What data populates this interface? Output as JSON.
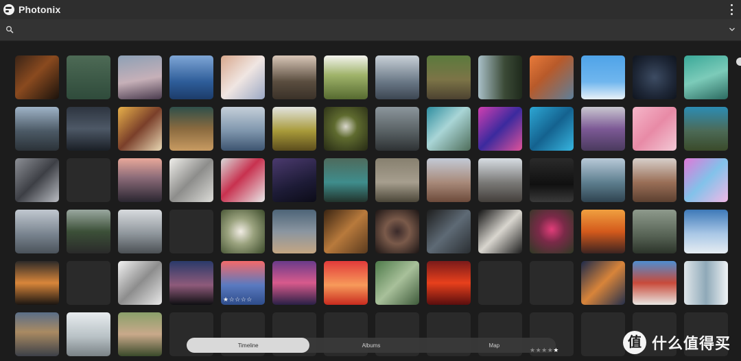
{
  "app": {
    "title": "Photonix"
  },
  "search": {
    "placeholder": ""
  },
  "icons": {
    "logo": "photonix-logo",
    "search": "search-icon",
    "menu": "more-vert-icon",
    "expand": "chevron-down-icon"
  },
  "tabs": [
    {
      "label": "Timeline",
      "active": true
    },
    {
      "label": "Albums",
      "active": false
    },
    {
      "label": "Map",
      "active": false
    }
  ],
  "watermark": {
    "text": "什么值得买"
  },
  "rows": [
    [
      {
        "bg": "linear-gradient(135deg,#3a2417 0%,#8a4a1f 45%,#1a120c 100%)"
      },
      {
        "bg": "linear-gradient(180deg,#4d6a55 0%,#2f4b3b 100%)"
      },
      {
        "bg": "linear-gradient(170deg,#8da0b5 0%,#c6b0b8 55%,#4a3b4e 100%)"
      },
      {
        "bg": "linear-gradient(180deg,#7fa6d6 0%,#2e5d99 60%,#1c3c6a 100%)"
      },
      {
        "bg": "linear-gradient(135deg,#d8a88d 0%,#f0e6e2 50%,#9aa7c4 100%)"
      },
      {
        "bg": "linear-gradient(180deg,#d9c7b8 0%,#5a4d3f 60%,#3a3128 100%)"
      },
      {
        "bg": "linear-gradient(180deg,#f4f4ef 0%,#9fb36a 45%,#566a30 100%)"
      },
      {
        "bg": "linear-gradient(180deg,#c9d1d8 0%,#6a7886 60%,#3c4652 100%)"
      },
      {
        "bg": "linear-gradient(180deg,#5b7a3d 0%,#7c7447 55%,#4c4230 100%)"
      },
      {
        "bg": "linear-gradient(90deg,#a9c0c8 0%,#3b4a36 60%,#1f2a1c 100%)"
      },
      {
        "bg": "linear-gradient(135deg,#e87a3a 0%,#b85a2a 40%,#5d7f9a 100%)"
      },
      {
        "bg": "linear-gradient(180deg,#4fa3e8 0%,#6fb6ee 60%,#e9f2f8 100%)"
      },
      {
        "bg": "radial-gradient(circle at 50% 50%,#3d4c63 0%,#1e2737 60%,#0f141d 100%)"
      },
      {
        "bg": "linear-gradient(160deg,#3aa898 0%,#7ccbb9 50%,#2b6a60 100%)"
      }
    ],
    [
      {
        "bg": "linear-gradient(180deg,#9fb3c7 0%,#4c5a66 55%,#2b3238 100%)"
      },
      {
        "bg": "linear-gradient(180deg,#2e3540 0%,#4d5866 50%,#1a1f26 100%)"
      },
      {
        "bg": "linear-gradient(135deg,#e7b04a 0%,#7a3f2a 50%,#e9d8b4 100%)"
      },
      {
        "bg": "linear-gradient(180deg,#2f4f4a 0%,#8a6a3f 50%,#c89b62 100%)"
      },
      {
        "bg": "linear-gradient(180deg,#c5cfd9 0%,#7f96ad 55%,#3d5470 100%)"
      },
      {
        "bg": "linear-gradient(180deg,#e2e4e0 0%,#a89a3a 55%,#5b4c1c 100%)"
      },
      {
        "bg": "radial-gradient(circle at 50% 45%,#d9d7cc 0%,#5f6b2f 35%,#262a14 100%)"
      },
      {
        "bg": "linear-gradient(180deg,#8c969c 0%,#555d60 60%,#2e3234 100%)"
      },
      {
        "bg": "linear-gradient(135deg,#2e8ea0 0%,#a9d5d6 45%,#4e6d5a 100%)"
      },
      {
        "bg": "linear-gradient(135deg,#d13fb0 0%,#3b2a9e 50%,#e0529a 100%)"
      },
      {
        "bg": "linear-gradient(135deg,#2da7d4 0%,#14628f 50%,#37b6e0 100%)"
      },
      {
        "bg": "linear-gradient(180deg,#c9c7d0 0%,#7d5a96 50%,#4a3a5e 100%)"
      },
      {
        "bg": "linear-gradient(135deg,#f5b6c9 0%,#e88aa6 50%,#f3cad6 100%)"
      },
      {
        "bg": "linear-gradient(180deg,#2c8cb3 0%,#4c6a56 55%,#3a4a2a 100%)"
      }
    ],
    [
      {
        "bg": "linear-gradient(135deg,#8c8f95 0%,#3d3f45 50%,#b9bcc2 100%)"
      },
      {
        "empty": true
      },
      {
        "bg": "linear-gradient(180deg,#e8a89a 0%,#8a6a78 45%,#2a2630 100%)"
      },
      {
        "bg": "linear-gradient(135deg,#efeeea 0%,#8d8d8b 50%,#dcdcd8 100%)"
      },
      {
        "bg": "linear-gradient(135deg,#d8d8d8 0%,#c8314f 45%,#e8e8e8 100%)"
      },
      {
        "bg": "linear-gradient(160deg,#4b3a6e 0%,#1d1b36 60%,#0c0c18 100%)"
      },
      {
        "bg": "linear-gradient(180deg,#4e6a5c 0%,#3f8d8c 55%,#22332c 100%)"
      },
      {
        "bg": "linear-gradient(180deg,#87806f 0%,#a69e8e 55%,#4b4638 100%)"
      },
      {
        "bg": "linear-gradient(180deg,#c3cad6 0%,#a88a7a 55%,#6d4a3a 100%)"
      },
      {
        "bg": "linear-gradient(180deg,#d7dde3 0%,#7b7a78 55%,#433f3b 100%)"
      },
      {
        "bg": "linear-gradient(180deg,#2a2a2a 0%,#101010 60%,#3a3a3a 100%)"
      },
      {
        "bg": "linear-gradient(180deg,#b8c9d8 0%,#5e7f8f 55%,#2f4350 100%)"
      },
      {
        "bg": "linear-gradient(180deg,#d7cfca 0%,#9a6f57 55%,#5c4030 100%)"
      },
      {
        "bg": "linear-gradient(135deg,#e078d8 0%,#82c2ea 50%,#f2b8e6 100%)"
      }
    ],
    [
      {
        "bg": "linear-gradient(180deg,#c1c8d0 0%,#7a8590 55%,#4a525a 100%)"
      },
      {
        "bg": "linear-gradient(180deg,#9aa8a0 0%,#3c5038 50%,#2a2a2a 100%)"
      },
      {
        "bg": "linear-gradient(180deg,#d8dbde 0%,#8f969c 55%,#4b5054 100%)"
      },
      {
        "empty": true
      },
      {
        "bg": "radial-gradient(circle at 45% 50%,#f1ece4 0%,#9aa27e 40%,#3b4a2a 100%)"
      },
      {
        "bg": "linear-gradient(180deg,#4d6478 0%,#8a95a0 50%,#c4a683 100%)"
      },
      {
        "bg": "linear-gradient(135deg,#3a2412 0%,#b87a3c 50%,#5a3a1e 100%)"
      },
      {
        "bg": "radial-gradient(circle at 50% 50%,#3a2a2a 0%,#7a5a4a 40%,#1a1414 100%)"
      },
      {
        "bg": "linear-gradient(135deg,#1e1e1e 0%,#5e6a75 50%,#2a2e32 100%)"
      },
      {
        "bg": "linear-gradient(135deg,#121212 0%,#d9d6cf 50%,#1e1e1e 100%)"
      },
      {
        "bg": "radial-gradient(circle at 50% 45%,#e23d7a 0%,#7a2a48 40%,#2e3a24 100%)"
      },
      {
        "bg": "linear-gradient(180deg,#f0a040 0%,#d45a1c 50%,#3e2420 100%)"
      },
      {
        "bg": "linear-gradient(180deg,#8e9a8c 0%,#566254 60%,#2c342a 100%)"
      },
      {
        "bg": "linear-gradient(180deg,#3d79b8 0%,#a9c7e6 55%,#e6edf2 100%)"
      }
    ],
    [
      {
        "bg": "linear-gradient(180deg,#2c2a28 0%,#d9863a 50%,#1a1512 100%)"
      },
      {
        "empty": true
      },
      {
        "bg": "linear-gradient(135deg,#f2f2f2 0%,#8d8d8d 50%,#e8e8e8 100%)"
      },
      {
        "bg": "linear-gradient(180deg,#2a3a6a 0%,#8e5a7a 55%,#0f0f12 100%)"
      },
      {
        "bg": "linear-gradient(180deg,#f46a6a 0%,#5a7ac0 55%,#2e4c8a 100%)",
        "stars": "★☆☆☆☆"
      },
      {
        "bg": "linear-gradient(180deg,#6a3a8a 0%,#d85a8c 50%,#2a2046 100%)"
      },
      {
        "bg": "linear-gradient(180deg,#e23a3a 0%,#f79a5a 55%,#c82a1e 100%)"
      },
      {
        "bg": "linear-gradient(135deg,#4e7a4a 0%,#a8c09a 50%,#3e5a3a 100%)"
      },
      {
        "bg": "linear-gradient(180deg,#7a1a1a 0%,#e8401c 50%,#5a0e0e 100%)"
      },
      {
        "empty": true
      },
      {
        "empty": true
      },
      {
        "bg": "linear-gradient(135deg,#1c2a4a 0%,#d8843a 50%,#25304c 100%)"
      },
      {
        "bg": "linear-gradient(180deg,#4f8ed0 0%,#c84a3a 50%,#e8e6e2 100%)"
      },
      {
        "bg": "linear-gradient(90deg,#dfe6ea 0%,#8fa9b8 50%,#eef2f4 100%)"
      }
    ],
    [
      {
        "bg": "linear-gradient(180deg,#5a6e88 0%,#a98a62 45%,#3c4048 100%)"
      },
      {
        "bg": "linear-gradient(180deg,#e8ecef 0%,#b9c2c6 55%,#7a8286 100%)"
      },
      {
        "bg": "linear-gradient(180deg,#8aa06a 0%,#c9a98a 50%,#3a4a2a 100%)"
      },
      {
        "empty": true
      },
      {
        "empty": true
      },
      {
        "empty": true
      },
      {
        "empty": true
      },
      {
        "empty": true
      },
      {
        "empty": true
      },
      {
        "empty": true
      },
      {
        "empty": true
      },
      {
        "empty": true
      },
      {
        "empty": true
      },
      {
        "empty": true
      }
    ]
  ],
  "footer_stars": {
    "text_off": "★★★★",
    "text_on": "★"
  }
}
